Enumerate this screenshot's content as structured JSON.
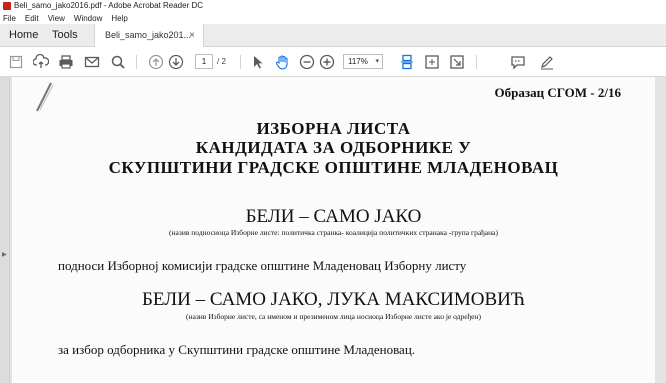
{
  "window": {
    "title": "Beli_samo_jako2016.pdf - Adobe Acrobat Reader DC"
  },
  "menu": [
    "File",
    "Edit",
    "View",
    "Window",
    "Help"
  ],
  "tabs": {
    "home": "Home",
    "tools": "Tools",
    "document": "Beli_samo_jako201...",
    "close_glyph": "×"
  },
  "toolbar": {
    "page_current": "1",
    "page_total": "/ 2",
    "zoom": "117%",
    "zoom_caret": "▾",
    "icons": [
      "save-icon",
      "upload-icon",
      "print-icon",
      "email-icon",
      "search-icon",
      "prev-page-icon",
      "next-page-icon",
      "select-arrow-icon",
      "hand-icon",
      "zoom-out-icon",
      "zoom-in-icon",
      "scroll-mode-icon",
      "fit-page-icon",
      "full-screen-icon",
      "comment-icon",
      "sign-icon"
    ]
  },
  "document": {
    "form_code": "Образац СГОМ - 2/16",
    "heading_line1": "ИЗБОРНА ЛИСТА",
    "heading_line2": "КАНДИДАТА ЗА ОДБОРНИКЕ У",
    "heading_line3": "СКУПШТИНИ ГРАДСКЕ ОПШТИНЕ МЛАДЕНОВАЦ",
    "list_name": "БЕЛИ – САМО ЈАКО",
    "list_name_caption": "(назив подносиоца Изборне листе: политичка странка- коалиција политичких странака -група грађана)",
    "submits_text": "подноси Изборној комисији градске општине Младеновац  Изборну листу",
    "list_full_name": "БЕЛИ – САМО ЈАКО, ЛУКА МАКСИМОВИЋ",
    "list_full_name_caption": "(назив Изборне листе, са именом и презименом лица носиоца Изборне листе ако је одређен)",
    "election_text": "за избор одборника у Скупштини градске општине Младеновац."
  },
  "colors": {
    "app_red": "#c8201e",
    "toolbar_icon": "#5a5a5a",
    "active_tool": "#1473e6"
  }
}
